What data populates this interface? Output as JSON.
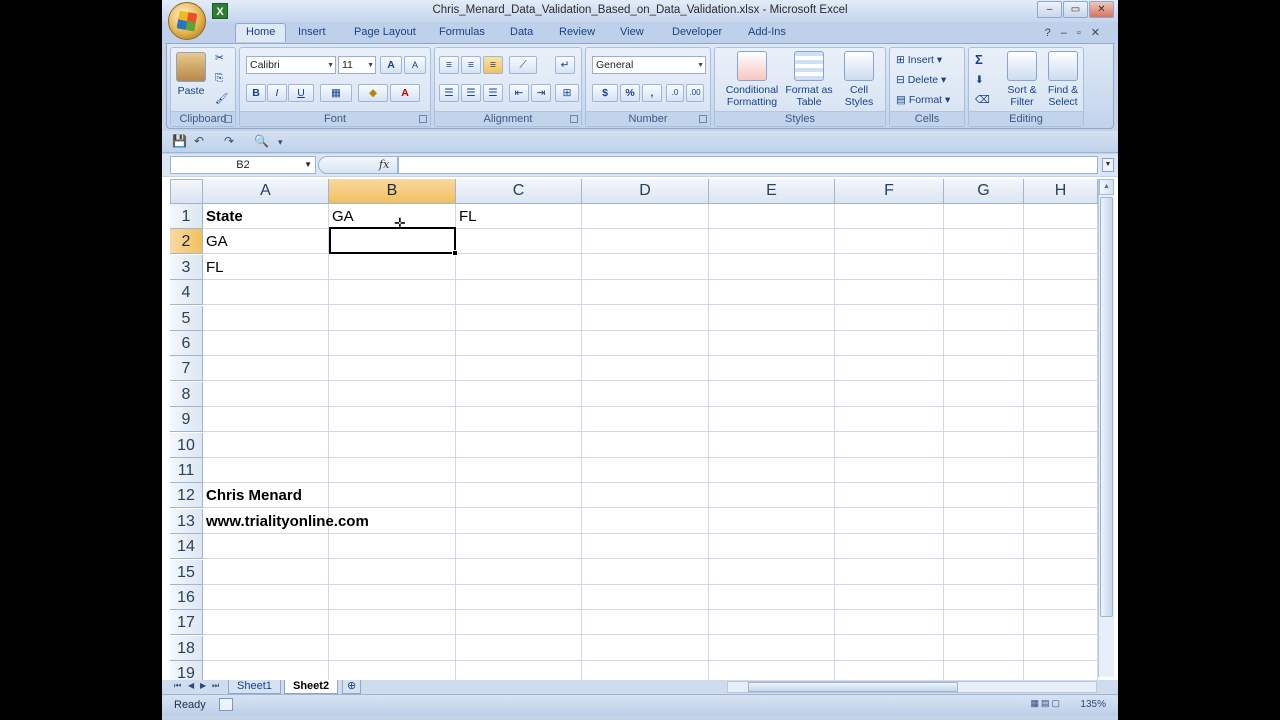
{
  "window": {
    "title": "Chris_Menard_Data_Validation_Based_on_Data_Validation.xlsx - Microsoft Excel",
    "controls": [
      "–",
      "▭",
      "✕"
    ]
  },
  "ribbon": {
    "tabs": [
      "Home",
      "Insert",
      "Page Layout",
      "Formulas",
      "Data",
      "Review",
      "View",
      "Developer",
      "Add-Ins"
    ],
    "active_tab": "Home",
    "groups": {
      "clipboard": {
        "label": "Clipboard",
        "paste": "Paste"
      },
      "font": {
        "label": "Font",
        "font_name": "Calibri",
        "font_size": "11",
        "bold": "B",
        "italic": "I",
        "underline": "U"
      },
      "alignment": {
        "label": "Alignment"
      },
      "number": {
        "label": "Number",
        "format": "General",
        "currency": "$",
        "percent": "%",
        "comma": ","
      },
      "styles": {
        "label": "Styles",
        "conditional": "Conditional Formatting",
        "format_table": "Format as Table",
        "cell_styles": "Cell Styles"
      },
      "cells": {
        "label": "Cells",
        "insert": "Insert",
        "delete": "Delete",
        "format": "Format"
      },
      "editing": {
        "label": "Editing",
        "sum": "Σ",
        "sort_filter": "Sort & Filter",
        "find_select": "Find & Select"
      }
    }
  },
  "formula_bar": {
    "name_box": "B2",
    "fx": "fx",
    "value": ""
  },
  "sheet": {
    "columns": [
      "A",
      "B",
      "C",
      "D",
      "E",
      "F",
      "G",
      "H"
    ],
    "selected_column": "B",
    "rows": [
      "1",
      "2",
      "3",
      "4",
      "5",
      "6",
      "7",
      "8",
      "9",
      "10",
      "11",
      "12",
      "13",
      "14",
      "15",
      "16",
      "17",
      "18",
      "19"
    ],
    "selected_row": "2",
    "cells": {
      "A1": "State",
      "B1": "GA",
      "C1": "FL",
      "A2": "GA",
      "A3": "FL",
      "A12": "Chris Menard",
      "A13": "www.trialityonline.com"
    }
  },
  "sheet_tabs": [
    "Sheet1",
    "Sheet2"
  ],
  "active_sheet": "Sheet2",
  "status": {
    "text": "Ready",
    "zoom": "135%"
  }
}
